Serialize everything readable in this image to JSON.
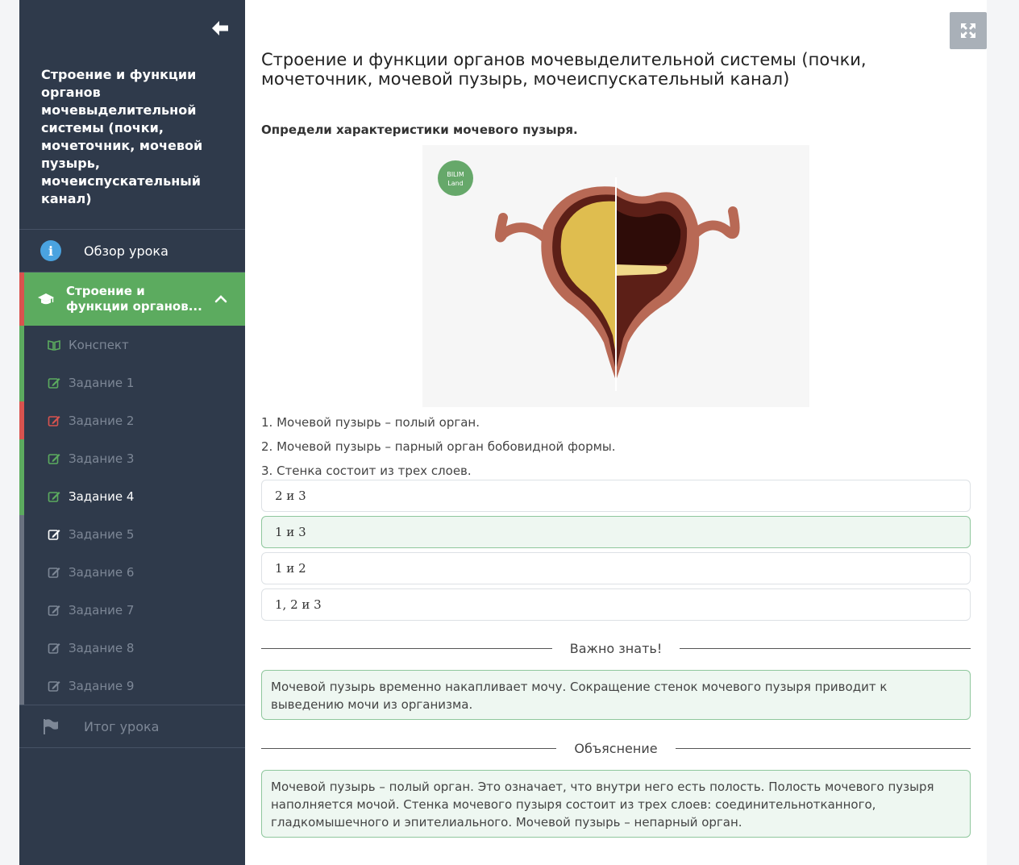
{
  "sidebar": {
    "title": "Строение и функции органов мочевыделительной системы (почки, мочеточник, мочевой пузырь, мочеиспускательный канал)",
    "overview_label": "Обзор урока",
    "active_section_label": "Строение и функции органов...",
    "items": [
      {
        "label": "Конспект",
        "color": "#7d8796",
        "stripe": "#5cab5f"
      },
      {
        "label": "Задание 1",
        "color": "#7d8796",
        "stripe": "#5cab5f"
      },
      {
        "label": "Задание 2",
        "color": "#7d8796",
        "stripe": "#d9534f"
      },
      {
        "label": "Задание 3",
        "color": "#7d8796",
        "stripe": "#5cab5f"
      },
      {
        "label": "Задание 4",
        "color": "#ffffff",
        "stripe": "#5cab5f"
      },
      {
        "label": "Задание 5",
        "color": "#7d8796",
        "stripe": "#6a7280"
      },
      {
        "label": "Задание 6",
        "color": "#7d8796",
        "stripe": "#6a7280"
      },
      {
        "label": "Задание 7",
        "color": "#7d8796",
        "stripe": "#6a7280"
      },
      {
        "label": "Задание 8",
        "color": "#7d8796",
        "stripe": "#6a7280"
      },
      {
        "label": "Задание 9",
        "color": "#7d8796",
        "stripe": "#6a7280"
      }
    ],
    "summary_label": "Итог урока"
  },
  "main": {
    "title": "Строение и функции органов мочевыделительной системы (почки, мочеточник, мочевой пузырь, мочеиспускательный канал)",
    "question": "Определи характеристики мочевого пузыря.",
    "logo_line1": "BILIM",
    "logo_line2": "Land",
    "statements": [
      {
        "num": "1.",
        "text": " Мочевой пузырь – полый орган."
      },
      {
        "num": "2.",
        "text": " Мочевой пузырь – парный орган бобовидной формы."
      },
      {
        "num": "3.",
        "text": " Стенка состоит из трех слоев."
      }
    ],
    "options": [
      {
        "label": "2 и 3",
        "correct": false
      },
      {
        "label": "1 и 3",
        "correct": true
      },
      {
        "label": "1 и 2",
        "correct": false
      },
      {
        "label": "1, 2 и 3",
        "correct": false
      }
    ],
    "important_heading": "Важно знать!",
    "important_text": "Мочевой пузырь временно накапливает мочу. Сокращение стенок мочевого пузыря приводит к выведению мочи из организма.",
    "explanation_heading": "Объяснение",
    "explanation_text": "Мочевой пузырь – полый орган. Это означает, что внутри него есть полость. Полость мочевого пузыря наполняется мочой. Стенка мочевого пузыря состоит из трех слоев: соединительнотканного, гладкомышечного и эпителиального. Мочевой пузырь – непарный орган."
  },
  "colors": {
    "sidebar_bg": "#2f3a4b",
    "active_green": "#5cab5f",
    "error_red": "#d9534f",
    "correct_bg": "#eef7f1",
    "correct_border": "#8fc79d"
  }
}
